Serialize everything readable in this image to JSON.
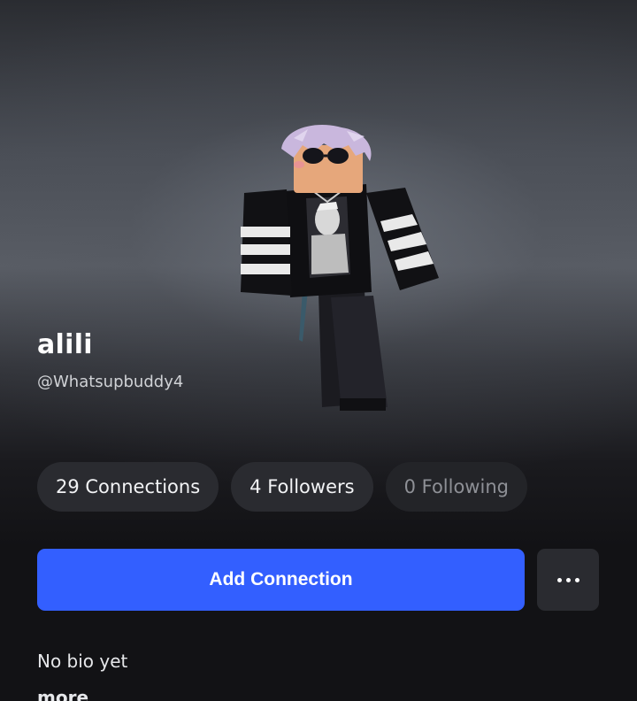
{
  "profile": {
    "display_name": "alili",
    "username": "@Whatsupbuddy4",
    "bio": "No bio yet",
    "more_label": "more"
  },
  "stats": {
    "connections": "29 Connections",
    "followers": "4 Followers",
    "following": "0 Following"
  },
  "actions": {
    "add_connection_label": "Add Connection",
    "more_icon": "ellipsis-icon"
  },
  "colors": {
    "primary_button": "#335fff",
    "pill_background": "#2a2b30",
    "page_background": "#121215"
  }
}
